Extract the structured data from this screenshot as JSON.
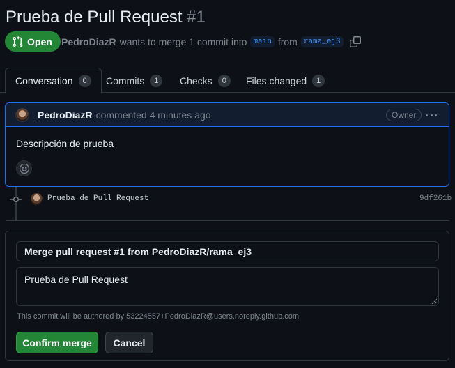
{
  "pr": {
    "title": "Prueba de Pull Request",
    "number": "#1",
    "state": "Open",
    "author": "PedroDiazR",
    "merge_text": "wants to merge 1 commit into",
    "base_branch": "main",
    "from_text": "from",
    "head_branch": "rama_ej3"
  },
  "tabs": [
    {
      "label": "Conversation",
      "count": "0"
    },
    {
      "label": "Commits",
      "count": "1"
    },
    {
      "label": "Checks",
      "count": "0"
    },
    {
      "label": "Files changed",
      "count": "1"
    }
  ],
  "comment": {
    "author": "PedroDiazR",
    "action": "commented 4 minutes ago",
    "role": "Owner",
    "body": "Descripción de prueba"
  },
  "commit": {
    "message": "Prueba de Pull Request",
    "sha": "9df261b"
  },
  "merge": {
    "title": "Merge pull request #1 from PedroDiazR/rama_ej3",
    "message": "Prueba de Pull Request",
    "author_note": "This commit will be authored by 53224557+PedroDiazR@users.noreply.github.com",
    "confirm_label": "Confirm merge",
    "cancel_label": "Cancel"
  },
  "icons": {
    "state": "git-pull-request-icon",
    "copy": "copy-icon",
    "kebab": "kebab-horizontal-icon",
    "reaction": "smiley-icon",
    "commit": "git-commit-icon"
  },
  "colors": {
    "background": "#0d1117",
    "open_green": "#238636",
    "accent_blue": "#1f6feb",
    "muted": "#7d8590"
  }
}
